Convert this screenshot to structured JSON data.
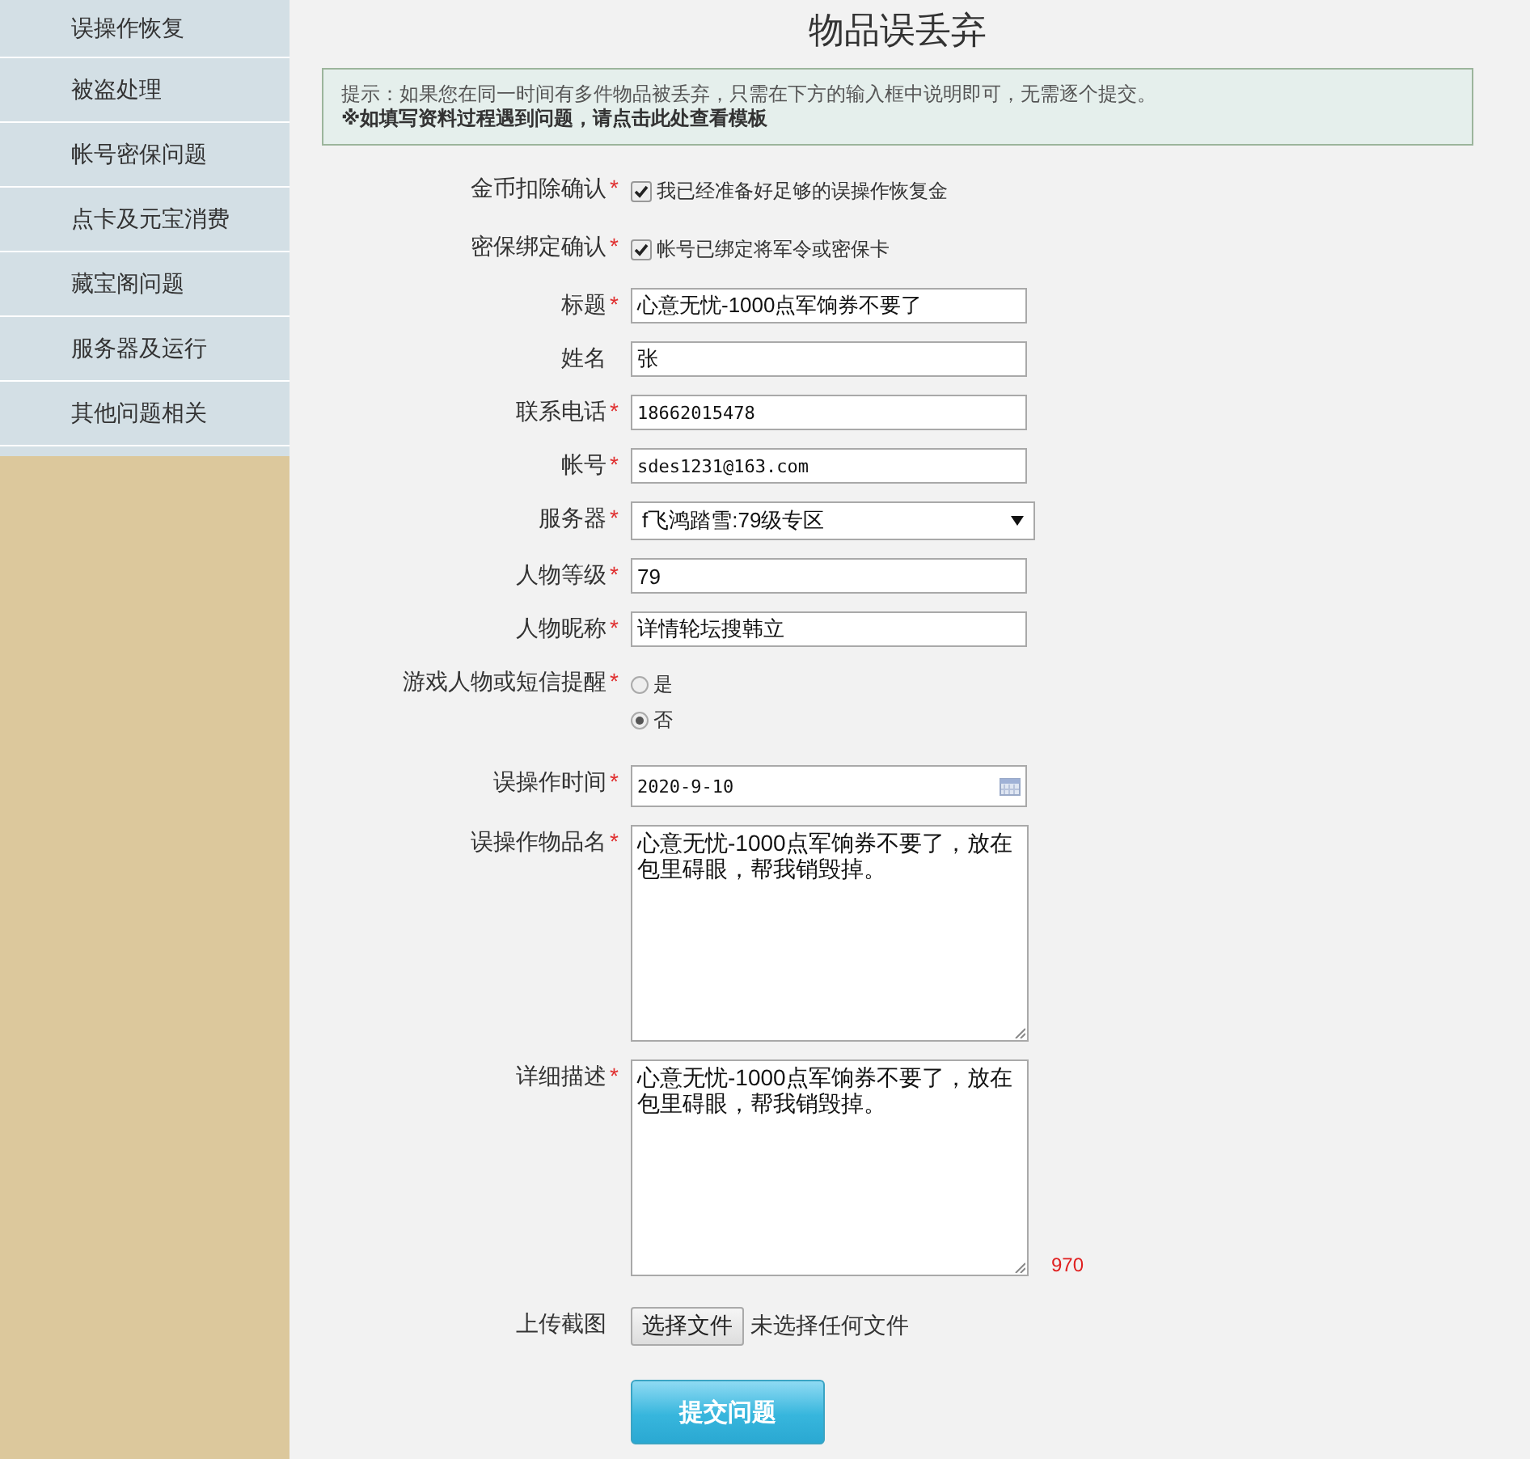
{
  "sidebar": {
    "items": [
      {
        "label": "误操作恢复",
        "selected": false
      },
      {
        "label": "被盗处理",
        "selected": false
      },
      {
        "label": "帐号密保问题",
        "selected": false
      },
      {
        "label": "点卡及元宝消费",
        "selected": false
      },
      {
        "label": "藏宝阁问题",
        "selected": false
      },
      {
        "label": "服务器及运行",
        "selected": false
      },
      {
        "label": "其他问题相关",
        "selected": false
      }
    ]
  },
  "page_title": "物品误丢弃",
  "hint": {
    "text": "提示：如果您在同一时间有多件物品被丢弃，只需在下方的输入框中说明即可，无需逐个提交。",
    "link": "※如填写资料过程遇到问题，请点击此处查看模板"
  },
  "form": {
    "fields": [
      {
        "kind": "checkbox",
        "label": "金币扣除确认",
        "required": true,
        "text": "我已经准备好足够的误操作恢复金",
        "checked": true
      },
      {
        "kind": "checkbox",
        "label": "密保绑定确认",
        "required": true,
        "text": "帐号已绑定将军令或密保卡",
        "checked": true
      },
      {
        "kind": "text",
        "label": "标题",
        "required": true,
        "value": "心意无忧-1000点军饷券不要了"
      },
      {
        "kind": "text",
        "label": "姓名",
        "required": false,
        "value": "张"
      },
      {
        "kind": "text",
        "label": "联系电话",
        "required": true,
        "value": "18662015478"
      },
      {
        "kind": "text",
        "label": "帐号",
        "required": true,
        "value": "sdes1231@163.com"
      },
      {
        "kind": "select",
        "label": "服务器",
        "required": true,
        "value": "f飞鸿踏雪:79级专区"
      },
      {
        "kind": "text",
        "label": "人物等级",
        "required": true,
        "value": "79"
      },
      {
        "kind": "text",
        "label": "人物昵称",
        "required": true,
        "value": "详情轮坛搜韩立"
      },
      {
        "kind": "radio",
        "label": "游戏人物或短信提醒",
        "required": true,
        "options": [
          {
            "label": "是",
            "selected": false
          },
          {
            "label": "否",
            "selected": true
          }
        ]
      },
      {
        "kind": "date",
        "label": "误操作时间",
        "required": true,
        "value": "2020-9-10"
      },
      {
        "kind": "textarea",
        "label": "误操作物品名",
        "required": true,
        "value": "心意无忧-1000点军饷券不要了，放在包里碍眼，帮我销毁掉。"
      },
      {
        "kind": "textarea",
        "label": "详细描述",
        "required": true,
        "value": "心意无忧-1000点军饷券不要了，放在包里碍眼，帮我销毁掉。",
        "counter": "970"
      },
      {
        "kind": "file",
        "label": "上传截图",
        "required": false,
        "button": "选择文件",
        "status": "未选择任何文件"
      }
    ]
  },
  "submit": "提交问题",
  "required_mark": "*"
}
